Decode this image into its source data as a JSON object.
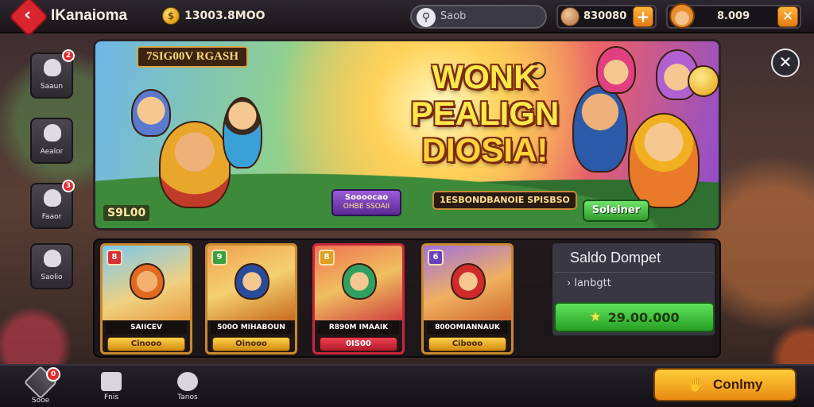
{
  "header": {
    "back_icon": "chevron-left-icon",
    "app_title": "IKanaioma",
    "coins": "13003.8MOO",
    "search_placeholder": "Saob",
    "gems": "830080",
    "gems_add": "+",
    "player_value": "8.009",
    "close": "✕"
  },
  "sidebar": {
    "items": [
      {
        "label": "Saaun",
        "icon": "mascot-icon",
        "badge": "2"
      },
      {
        "label": "Aealor",
        "icon": "monster-icon",
        "badge": ""
      },
      {
        "label": "Faaor",
        "icon": "pet-icon",
        "badge": "3"
      },
      {
        "label": "Saolio",
        "icon": "creature-icon",
        "badge": ""
      }
    ]
  },
  "banner": {
    "tag": "7SIG00V RGASH",
    "title_line1": "WONK",
    "title_line2": "PEALIGN",
    "title_line3": "DIOSIA!",
    "price": "S9L00",
    "purple_btn_line1": "Soooocao",
    "purple_btn_line2": "OHBE SSOAII",
    "info_text": "1ESBONDBANOIE SPISBSO",
    "green_btn": "Soleiner",
    "close": "✕"
  },
  "cards": [
    {
      "label": "SAIICEV",
      "price": "Cinooo",
      "corner": "8",
      "style": "gold"
    },
    {
      "label": "500O MIHABOUN",
      "price": "Oinooo",
      "corner": "9",
      "style": "gold"
    },
    {
      "label": "R890M IMAAIK",
      "price": "0IS00",
      "corner": "8",
      "style": "red"
    },
    {
      "label": "800OMIANNAUK",
      "price": "Cibooo",
      "corner": "6",
      "style": "gold"
    }
  ],
  "wallet": {
    "title": "Saldo Dompet",
    "subtitle": "› lanbgtt",
    "value": "29.00.000",
    "star_icon": "star-icon"
  },
  "bottom_nav": {
    "tabs": [
      {
        "label": "Sooe",
        "icon": "home-icon",
        "badge": "0"
      },
      {
        "label": "Fnis",
        "icon": "edit-icon",
        "badge": ""
      },
      {
        "label": "Tanos",
        "icon": "eye-icon",
        "badge": ""
      }
    ],
    "confirm_label": "Conlmy",
    "confirm_icon": "hand-icon"
  },
  "colors": {
    "accent_orange": "#e88a10",
    "accent_green": "#27a023",
    "accent_red": "#d9262e",
    "panel_dark": "#1a1418"
  }
}
